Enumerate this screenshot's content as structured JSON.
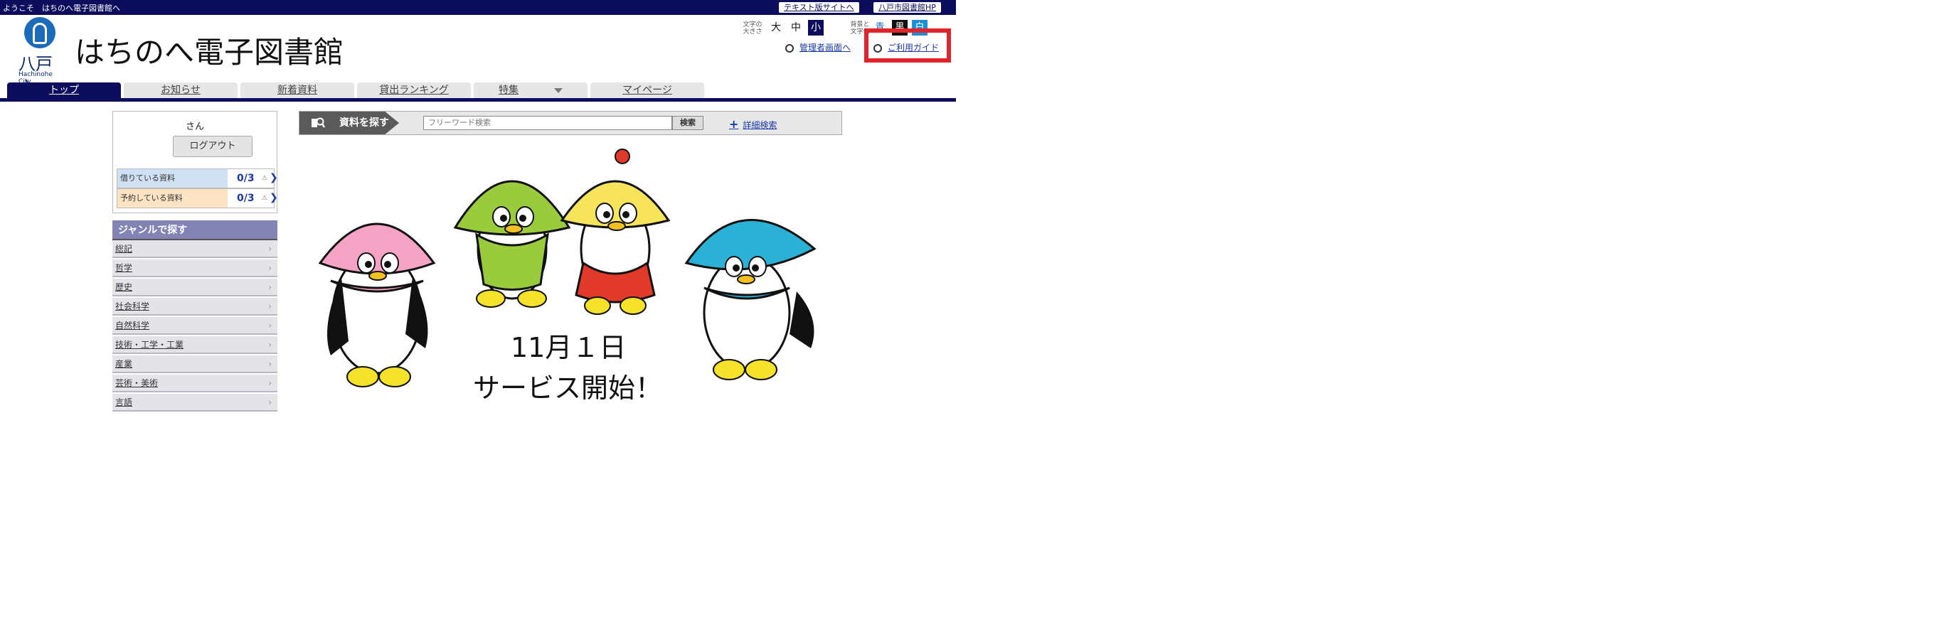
{
  "header": {
    "welcome": "ようこそ　はちのへ電子図書館へ",
    "text_site_link": "テキスト版サイトへ",
    "city_hp_link": "八戸市図書館HP",
    "logo_text": "八戸市",
    "logo_sub": "Hachinohe City",
    "site_title": "はちのへ電子図書館",
    "font_size_label": "文字の大きさ",
    "font_sizes": [
      "大",
      "中",
      "小"
    ],
    "color_label": "背景と文字色",
    "color_options": [
      "青",
      "黒",
      "白"
    ],
    "admin_link": "管理者画面へ",
    "guide_link": "ご利用ガイド"
  },
  "nav": {
    "tabs": [
      "トップ",
      "お知らせ",
      "新着資料",
      "貸出ランキング",
      "特集",
      "マイページ"
    ]
  },
  "user": {
    "name": "さん",
    "logout": "ログアウト",
    "borrowed_label": "借りている資料",
    "borrowed_value": "0/3",
    "reserved_label": "予約している資料",
    "reserved_value": "0/3"
  },
  "genre": {
    "heading": "ジャンルで探す",
    "items": [
      "総記",
      "哲学",
      "歴史",
      "社会科学",
      "自然科学",
      "技術・工学・工業",
      "産業",
      "芸術・美術",
      "言語"
    ]
  },
  "search": {
    "label": "資料を探す",
    "placeholder": "フリーワード検索",
    "button": "検索",
    "advanced": "詳細検索"
  },
  "banner": {
    "line1": "11月１日",
    "line2": "サービス開始！"
  },
  "colors": {
    "navy": "#0d0d5e",
    "genre_header": "#8484b4",
    "highlight": "#e0242c"
  }
}
